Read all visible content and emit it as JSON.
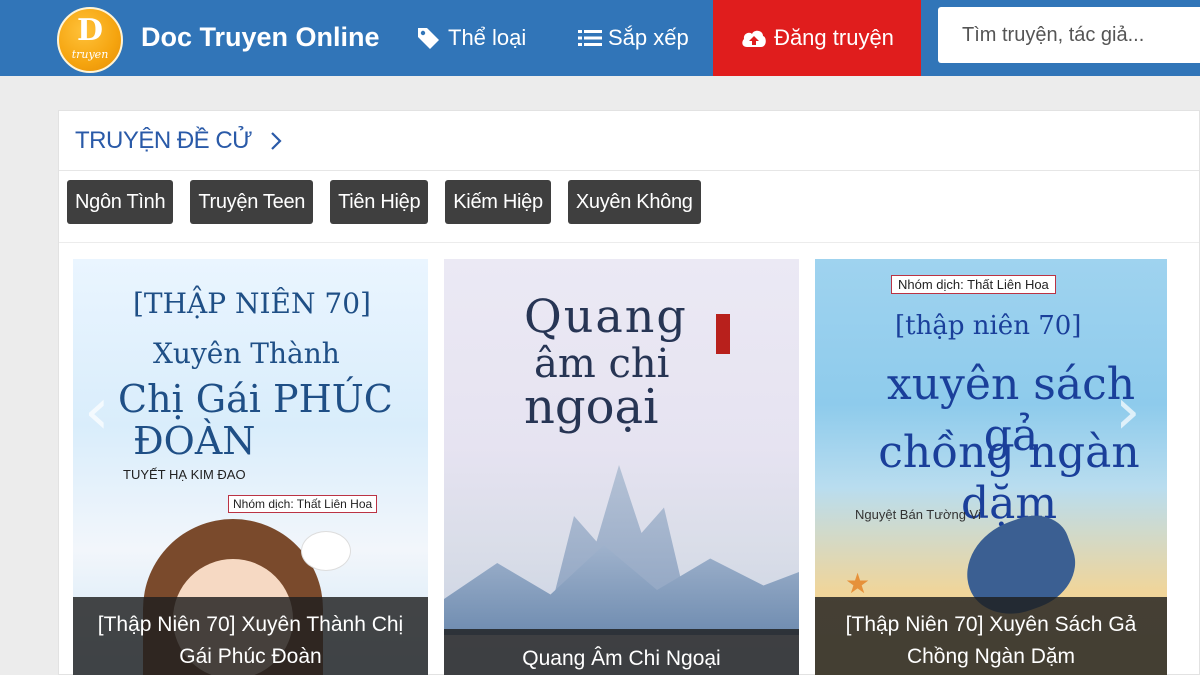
{
  "header": {
    "logo": {
      "letter": "D",
      "sub": "truyen"
    },
    "brand": "Doc Truyen Online",
    "nav": {
      "genre": "Thể loại",
      "sort": "Sắp xếp",
      "upload": "Đăng truyện"
    },
    "search_placeholder": "Tìm truyện, tác giả..."
  },
  "section": {
    "title": "TRUYỆN ĐỀ CỬ",
    "tags": [
      "Ngôn Tình",
      "Truyện Teen",
      "Tiên Hiệp",
      "Kiếm Hiệp",
      "Xuyên Không"
    ]
  },
  "cards": [
    {
      "caption": "[Thập Niên 70] Xuyên Thành Chị Gái Phúc Đoàn",
      "cover": {
        "series": "[THẬP NIÊN 70]",
        "line1": "Xuyên Thành",
        "line2": "Chị Gái PHÚC",
        "line3": "ĐOÀN",
        "author": "TUYẾT HẠ KIM ĐAO",
        "group": "Nhóm dịch: Thất Liên Hoa"
      }
    },
    {
      "caption": "Quang Âm Chi Ngoại",
      "cover": {
        "line1": "Quang",
        "line2": "âm chi",
        "line3": "ngoại"
      }
    },
    {
      "caption": "[Thập Niên 70] Xuyên Sách Gả Chồng Ngàn Dặm",
      "cover": {
        "group": "Nhóm dịch: Thất Liên Hoa",
        "series": "[thập niên 70]",
        "line1": "xuyên sách gả",
        "line2": "chồng ngàn dặm",
        "author": "Nguyệt Bán Tường Vi"
      }
    }
  ],
  "colors": {
    "navbar": "#3175b8",
    "upload_button": "#e01d1d",
    "section_title": "#2a5aa8",
    "tag_bg": "#3f3f3f"
  }
}
